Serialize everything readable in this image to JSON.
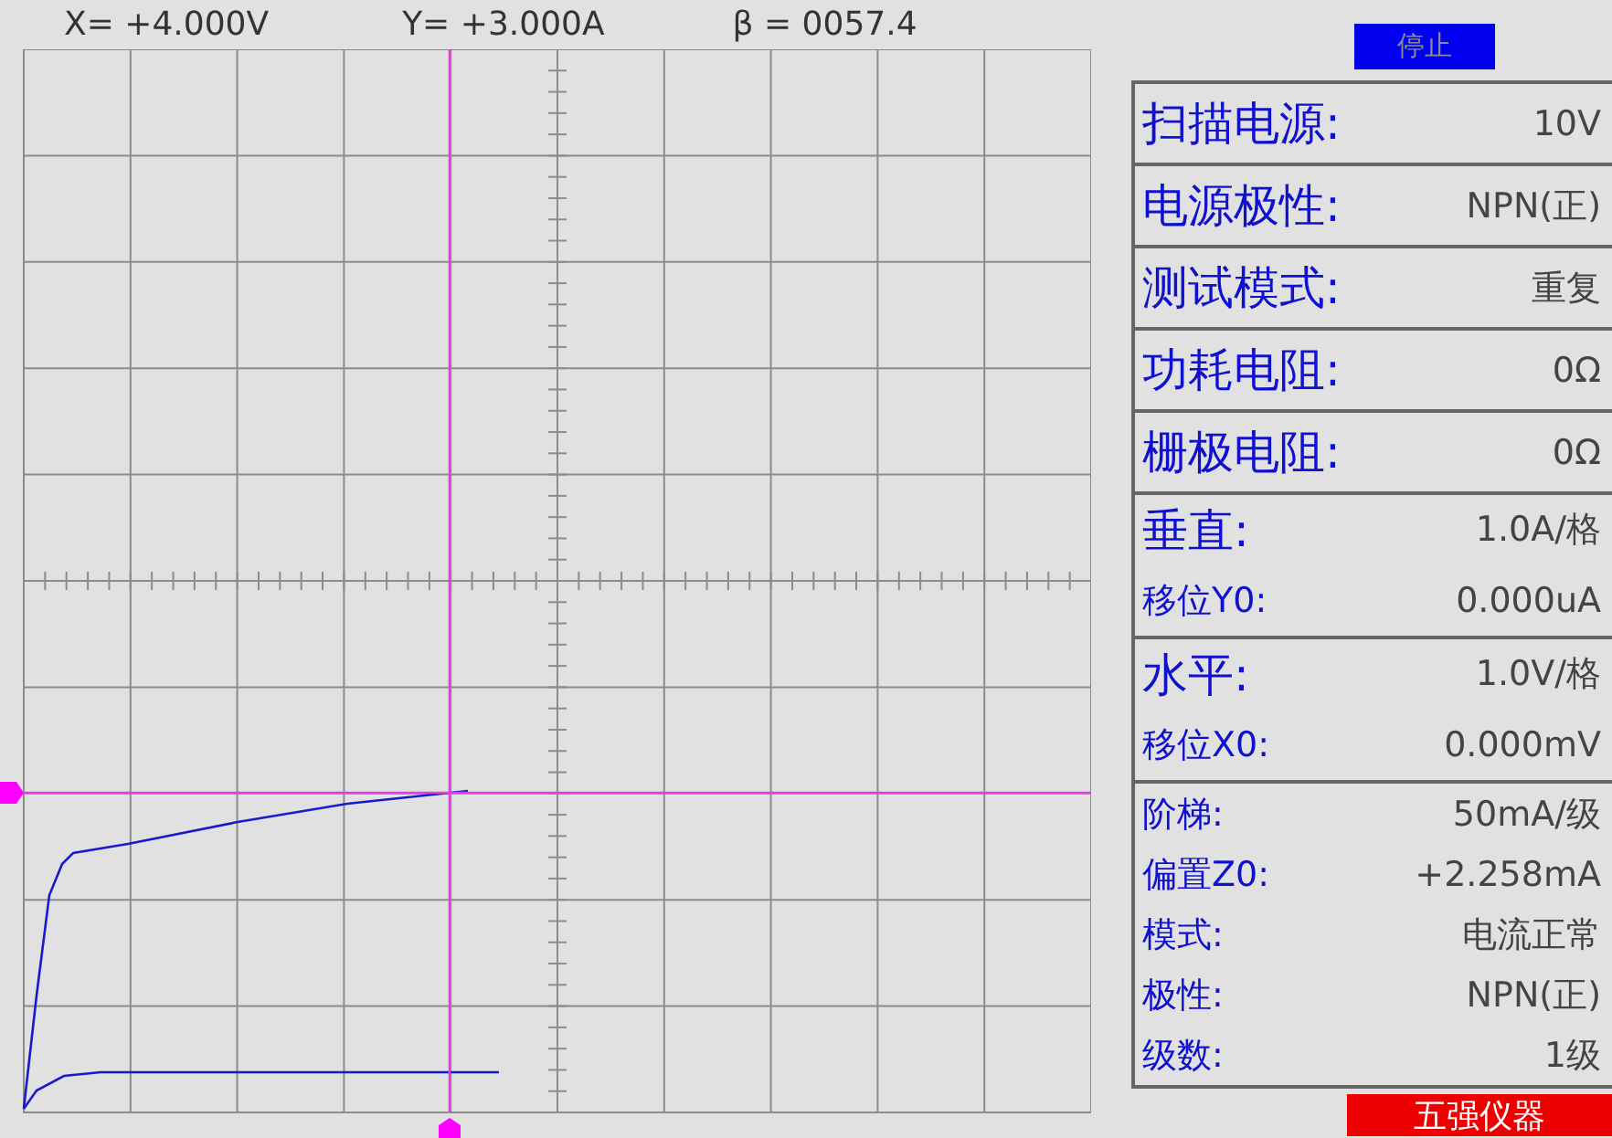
{
  "readouts": [
    {
      "text": "X= +4.000V"
    },
    {
      "text": "Y= +3.000A"
    },
    {
      "text": "β = 0057.4"
    }
  ],
  "stop_button": {
    "label": "停止"
  },
  "settings": [
    {
      "rows": [
        {
          "kind": "major",
          "label": "扫描电源:",
          "value": "10V"
        }
      ]
    },
    {
      "rows": [
        {
          "kind": "major",
          "label": "电源极性:",
          "value": "NPN(正)"
        }
      ]
    },
    {
      "rows": [
        {
          "kind": "major",
          "label": "测试模式:",
          "value": "重复"
        }
      ]
    },
    {
      "rows": [
        {
          "kind": "major",
          "label": "功耗电阻:",
          "value": "0Ω"
        }
      ]
    },
    {
      "rows": [
        {
          "kind": "major",
          "label": "栅极电阻:",
          "value": "0Ω"
        }
      ]
    },
    {
      "rows": [
        {
          "kind": "major",
          "label": "垂直:",
          "value": "1.0A/格"
        },
        {
          "kind": "minor",
          "label": "移位Y0:",
          "value": "0.000uA"
        }
      ]
    },
    {
      "rows": [
        {
          "kind": "major",
          "label": "水平:",
          "value": "1.0V/格"
        },
        {
          "kind": "minor",
          "label": "移位X0:",
          "value": "0.000mV"
        }
      ]
    },
    {
      "rows": [
        {
          "kind": "compact",
          "label": "阶梯:",
          "value": "50mA/级"
        },
        {
          "kind": "compact",
          "label": "偏置Z0:",
          "value": "+2.258mA"
        },
        {
          "kind": "compact",
          "label": "模式:",
          "value": "电流正常"
        },
        {
          "kind": "compact",
          "label": "极性:",
          "value": "NPN(正)"
        },
        {
          "kind": "compact",
          "label": "级数:",
          "value": "1级"
        }
      ]
    }
  ],
  "brand": {
    "text": "五强仪器"
  }
}
